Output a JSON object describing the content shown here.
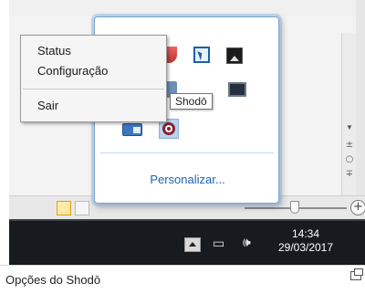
{
  "context_menu": {
    "items": [
      {
        "label": "Status"
      },
      {
        "label": "Configuração"
      },
      {
        "label": "Sair"
      }
    ]
  },
  "tray_flyout": {
    "tooltip": "Shodō",
    "customize_link": "Personalizar...",
    "icons": [
      "security-shield-icon",
      "cursor-app-icon",
      "photo-app-icon",
      "shield-icon",
      "monitor-icon",
      "card-icon",
      "shodo-app-icon"
    ]
  },
  "taskbar": {
    "time": "14:34",
    "date": "29/03/2017",
    "icons": [
      "show-hidden-icons-arrow",
      "network-icon",
      "volume-icon"
    ]
  },
  "caption": {
    "text": "Opções do Shodō"
  },
  "colors": {
    "taskbar": "#171b1f",
    "link": "#1e63b4",
    "flyout_border": "#7aa6cc",
    "shodo_brand": "#8a2134"
  }
}
